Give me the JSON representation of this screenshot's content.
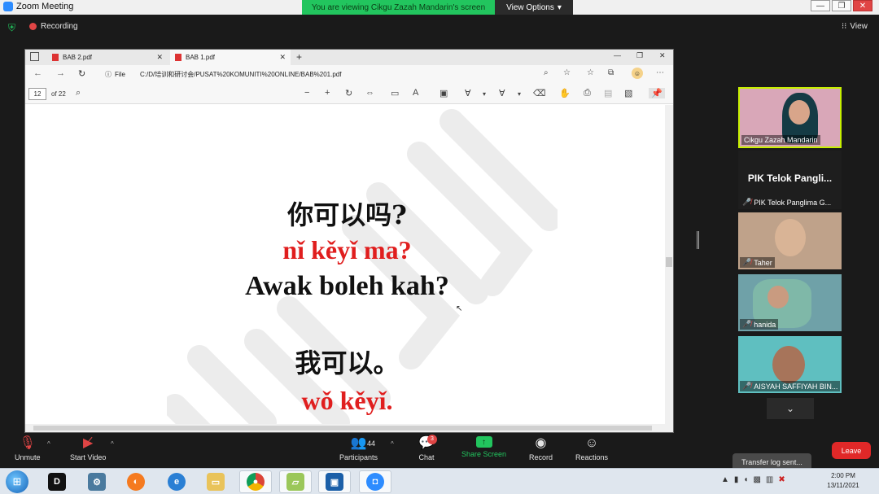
{
  "zoom": {
    "window_title": "Zoom Meeting",
    "viewing_banner": "You are viewing Cikgu Zazah Mandarin's screen",
    "view_options": "View Options",
    "recording": "Recording",
    "view_label": "View"
  },
  "browser": {
    "tabs": [
      {
        "label": "BAB 2.pdf"
      },
      {
        "label": "BAB 1.pdf"
      }
    ],
    "file_label": "File",
    "url": "C:/D/培训和研讨会/PUSAT%20KOMUNITI%20ONLINE/BAB%201.pdf",
    "page_current": "12",
    "page_total": "of 22"
  },
  "slide": {
    "zh1": "你可以吗?",
    "py1": "nǐ kěyǐ ma?",
    "ms1": "Awak boleh kah?",
    "zh2": "我可以。",
    "py2": "wǒ kěyǐ."
  },
  "participants": {
    "host": "Cikgu Zazah Mandarin",
    "pik_big": "PIK Telok Pangli...",
    "pik": "PIK Telok Panglima G...",
    "taher": "Taher",
    "hanida": "hanida",
    "aisyah": "AISYAH SAFFIYAH BIN..."
  },
  "controls": {
    "unmute": "Unmute",
    "start_video": "Start Video",
    "participants": "Participants",
    "participant_count": "44",
    "chat": "Chat",
    "chat_badge": "3",
    "share_screen": "Share Screen",
    "record": "Record",
    "reactions": "Reactions",
    "leave": "Leave",
    "toast": "Transfer log sent..."
  },
  "taskbar": {
    "time": "2:00 PM",
    "date": "13/11/2021"
  },
  "colors": {
    "banner_green": "#22c55e",
    "pinyin_red": "#e01e1e",
    "leave_red": "#e02828",
    "speaker_border": "#c7f000"
  }
}
